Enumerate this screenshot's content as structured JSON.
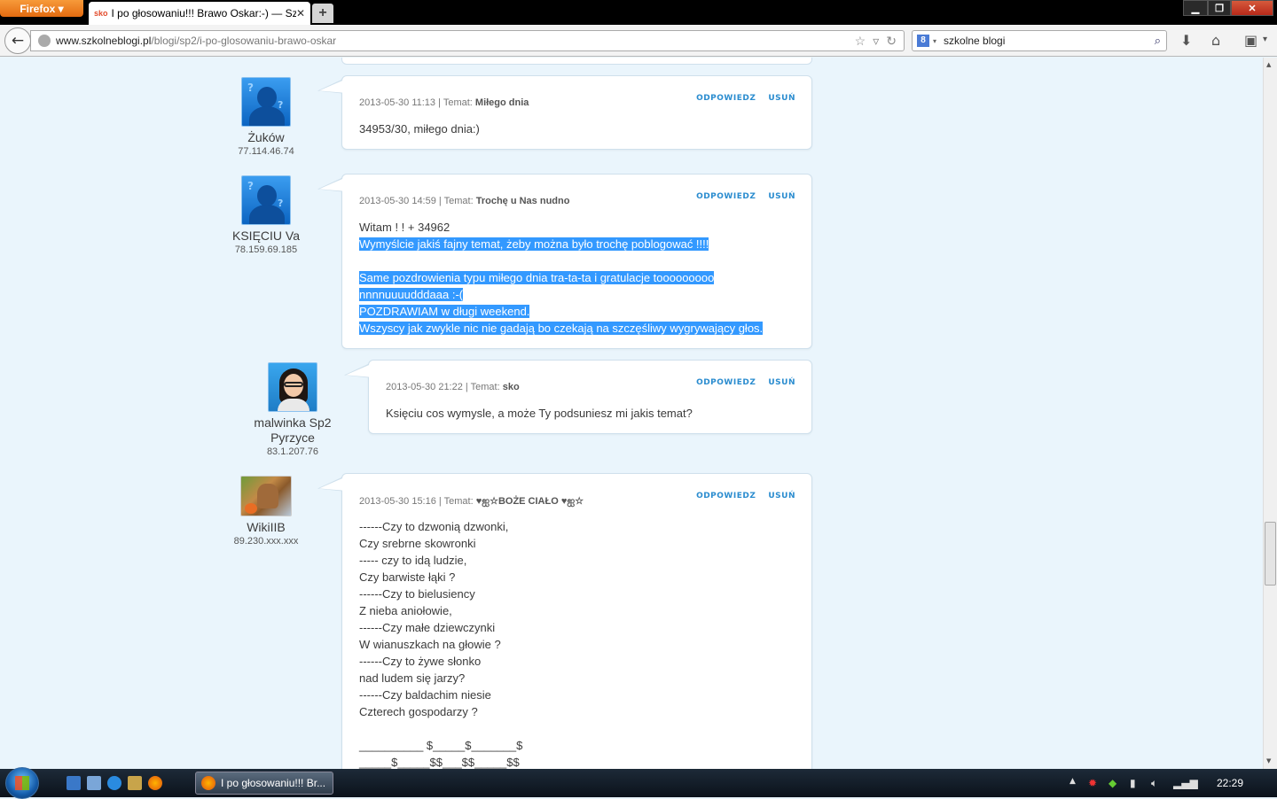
{
  "browser": {
    "menu_label": "Firefox",
    "tab_title": "I po głosowaniu!!! Brawo Oskar:-) — Szk...",
    "tab_favicon": "sko",
    "url_host": "www.szkolneblogi.pl",
    "url_path": "/blogi/sp2/i-po-glosowaniu-brawo-oskar",
    "search_value": "szkolne blogi",
    "search_engine": "8"
  },
  "actions": {
    "reply": "ODPOWIEDZ",
    "delete": "USUŃ"
  },
  "comments": [
    {
      "name": "Żuków",
      "ip": "77.114.46.74",
      "date": "2013-05-30 11:13",
      "topic_label": "| Temat:",
      "topic": "Miłego dnia",
      "text": "34953/30, miłego dnia:)"
    },
    {
      "name": "KSIĘCIU Va",
      "ip": "78.159.69.185",
      "date": "2013-05-30 14:59",
      "topic_label": "| Temat:",
      "topic": "Trochę u Nas nudno",
      "text_plain": "Witam ! ! + 34962",
      "text_selected": [
        "Wymyślcie jakiś fajny temat, żeby można było trochę poblogować !!!!",
        "",
        "Same pozdrowienia typu miłego dnia tra-ta-ta i gratulacje tooooooooo",
        "nnnnuuuudddaaa :-(",
        "POZDRAWIAM w długi weekend.",
        "Wszyscy jak zwykle nic nie gadają bo czekają na szczęśliwy wygrywający głos."
      ]
    },
    {
      "name": "malwinka Sp2",
      "name2": "Pyrzyce",
      "ip": "83.1.207.76",
      "date": "2013-05-30 21:22",
      "topic_label": "| Temat:",
      "topic": "sko",
      "text": "Księciu cos wymysle, a może Ty podsuniesz mi jakis temat?"
    },
    {
      "name": "WikiIIB",
      "ip": "89.230.xxx.xxx",
      "date": "2013-05-30 15:16",
      "topic_label": "| Temat:",
      "topic": "♥ஐ☆BOŻE CIAŁO ♥ஐ☆",
      "text": "------Czy to dzwonią dzwonki,\nCzy srebrne skowronki\n----- czy to idą ludzie,\nCzy barwiste łąki ?\n------Czy to bielusiency\nZ nieba aniołowie,\n------Czy małe dziewczynki\nW wianuszkach na głowie ?\n------Czy to żywe słonko\nnad ludem się jarzy?\n------Czy baldachim niesie\nCzterech gospodarzy ?\n\n__________ $_____$_______$\n_____$_____$$___$$_____$$"
    }
  ],
  "taskbar": {
    "window_title": "I po głosowaniu!!! Br...",
    "clock": "22:29"
  },
  "icons": {
    "back": "back-arrow-icon",
    "star": "bookmark-star-icon",
    "reload": "reload-icon",
    "search": "magnifier-icon",
    "download": "download-icon",
    "home": "home-icon",
    "addon": "addon-icon"
  },
  "colors": {
    "page_bg": "#eaf5fc",
    "action_blue": "#2a8ccf",
    "selection": "#3399ff",
    "firefox_orange": "#e36b10"
  }
}
